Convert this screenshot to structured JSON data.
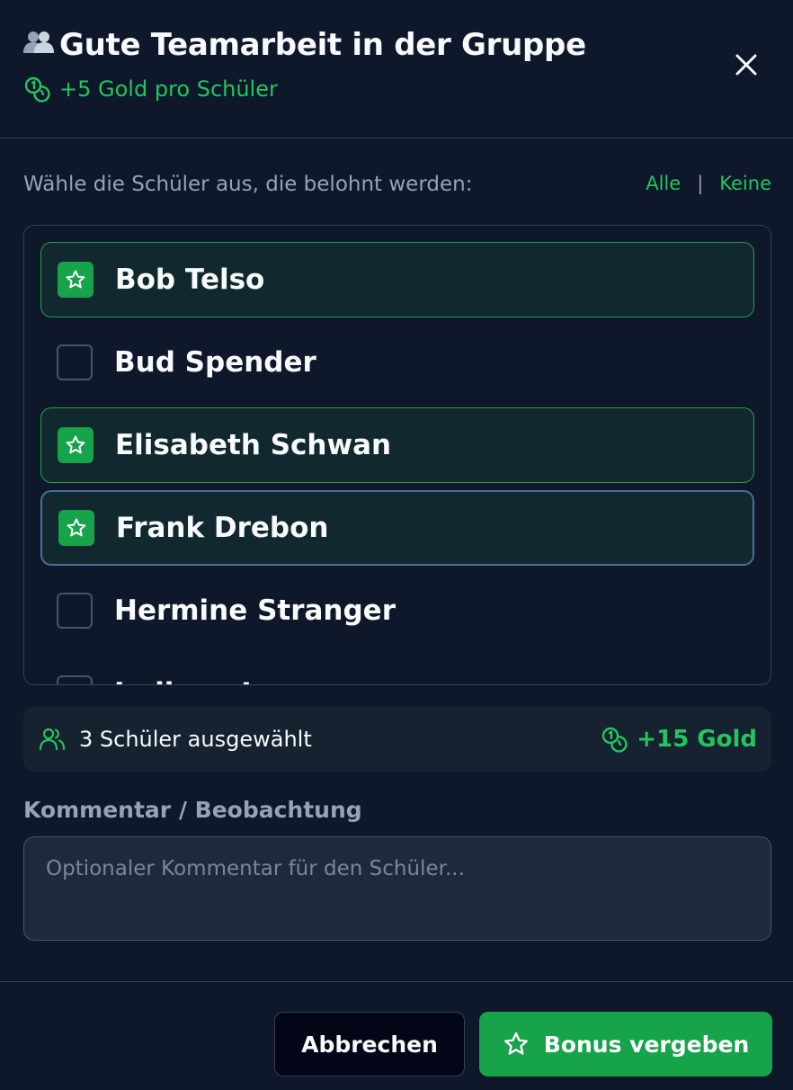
{
  "header": {
    "title": "Gute Teamarbeit in der Gruppe",
    "title_icon": "people-icon",
    "reward_text": "+5 Gold pro Schüler",
    "reward_icon": "coins-icon",
    "close_icon": "close-icon"
  },
  "selection": {
    "instruction": "Wähle die Schüler aus, die belohnt werden:",
    "select_all": "Alle",
    "separator": "|",
    "select_none": "Keine"
  },
  "students": [
    {
      "name": "Bob Telso",
      "selected": true
    },
    {
      "name": "Bud Spender",
      "selected": false
    },
    {
      "name": "Elisabeth Schwan",
      "selected": true
    },
    {
      "name": "Frank Drebon",
      "selected": true,
      "focused": true
    },
    {
      "name": "Hermine Stranger",
      "selected": false
    },
    {
      "name": "Indiana Jones",
      "selected": false
    }
  ],
  "summary": {
    "selected_count_text": "3 Schüler ausgewählt",
    "total_gold": "+15 Gold",
    "users_icon": "users-icon",
    "coins_icon": "coins-icon"
  },
  "comment": {
    "label": "Kommentar / Beobachtung",
    "placeholder": "Optionaler Kommentar für den Schüler..."
  },
  "footer": {
    "cancel_label": "Abbrechen",
    "submit_label": "Bonus vergeben",
    "submit_icon": "star-icon"
  },
  "colors": {
    "background": "#0f172a",
    "accent": "#16a34a",
    "accent_text": "#22c55e",
    "muted_text": "#94a3b8",
    "border": "#334155",
    "selected_bg": "#11282f",
    "focus_border": "#4a6f99"
  }
}
